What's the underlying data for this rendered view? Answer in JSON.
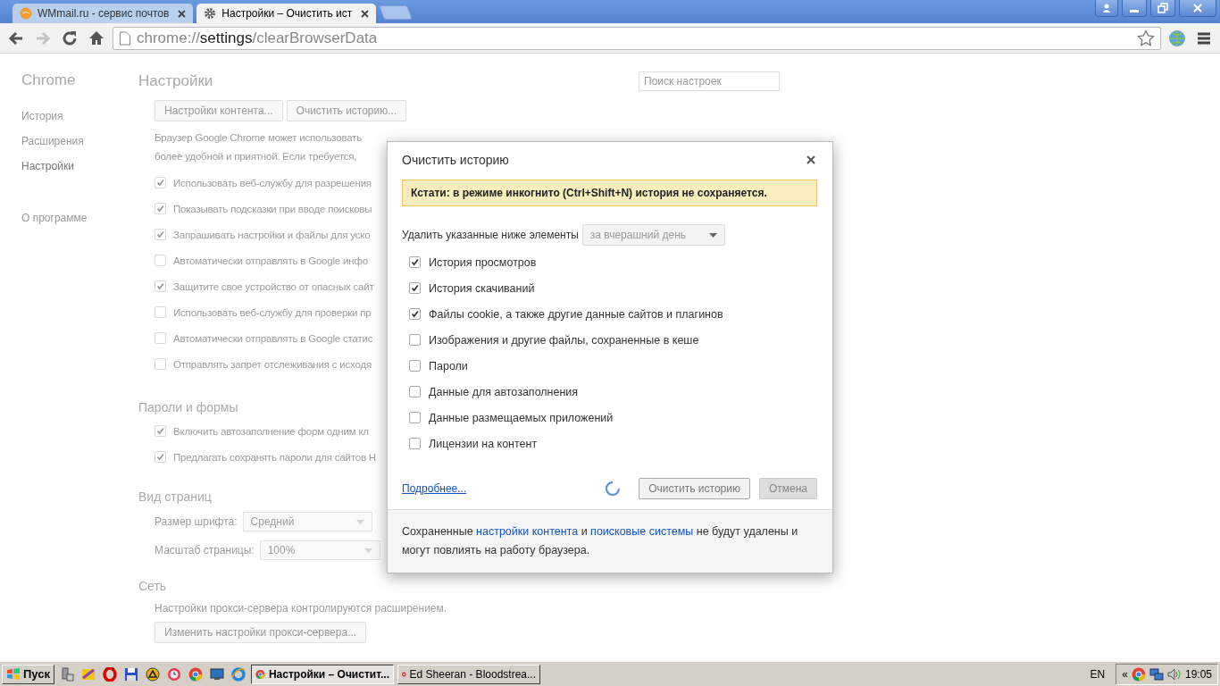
{
  "tabs": [
    {
      "label": "WMmail.ru - сервис почтов",
      "selected": false
    },
    {
      "label": "Настройки – Очистить ист",
      "selected": true
    }
  ],
  "address_bar": {
    "url_parts": [
      "chrome://",
      "settings",
      "/clearBrowserData"
    ]
  },
  "sidebar": {
    "title": "Chrome",
    "items": [
      {
        "label": "История",
        "selected": false
      },
      {
        "label": "Расширения",
        "selected": false
      },
      {
        "label": "Настройки",
        "selected": true
      },
      {
        "label": "О программе",
        "selected": false
      }
    ]
  },
  "settings": {
    "title": "Настройки",
    "search": {
      "placeholder": "Поиск настроек"
    },
    "buttons": [
      "Настройки контента...",
      "Очистить историю..."
    ],
    "description": [
      "Браузер Google Chrome может использовать",
      "более удобной и приятной. Если требуется,"
    ],
    "options": [
      {
        "label": "Использовать веб-службу для разрешения",
        "checked": true
      },
      {
        "label": "Показывать подсказки при вводе поисковы",
        "checked": true
      },
      {
        "label": "Запрашивать настройки и файлы для уско",
        "checked": true
      },
      {
        "label": "Автоматически отправлять в Google инфо",
        "checked": false
      },
      {
        "label": "Защитите свое устройство от опасных сайт",
        "checked": true
      },
      {
        "label": "Использовать веб-службу для проверки пр",
        "checked": false
      },
      {
        "label": "Автоматически отправлять в Google статис",
        "checked": false
      },
      {
        "label": "Отправлять запрет отслеживания с исходя",
        "checked": false
      }
    ],
    "passwords": {
      "title": "Пароли и формы",
      "options": [
        {
          "label": "Включить автозаполнение форм одним кл",
          "checked": true
        },
        {
          "label": "Предлагать сохранять пароли для сайтов Н",
          "checked": true
        }
      ]
    },
    "appearance": {
      "title": "Вид страниц",
      "font_size": {
        "label": "Размер шрифта:",
        "value": "Средний"
      },
      "zoom": {
        "label": "Масштаб страницы:",
        "value": "100%"
      }
    },
    "network": {
      "title": "Сеть",
      "text": "Настройки прокси-сервера контролируются расширением.",
      "button": "Изменить настройки прокси-сервера..."
    }
  },
  "dialog": {
    "title": "Очистить историю",
    "notice": "Кстати: в режиме инкогнито (Ctrl+Shift+N) история не сохраняется.",
    "period": {
      "label": "Удалить указанные ниже элементы",
      "value": "за вчерашний день"
    },
    "items": [
      {
        "label": "История просмотров",
        "checked": true
      },
      {
        "label": "История скачиваний",
        "checked": true
      },
      {
        "label": "Файлы cookie, а также другие данные сайтов и плагинов",
        "checked": true
      },
      {
        "label": "Изображения и другие файлы, сохраненные в кеше",
        "checked": false
      },
      {
        "label": "Пароли",
        "checked": false
      },
      {
        "label": "Данные для автозаполнения",
        "checked": false
      },
      {
        "label": "Данные размещаемых приложений",
        "checked": false
      },
      {
        "label": "Лицензии на контент",
        "checked": false
      }
    ],
    "more_link": "Подробнее...",
    "buttons": [
      {
        "label": "Очистить историю",
        "kind": "primary",
        "disabled": true
      },
      {
        "label": "Отмена",
        "kind": "cancel",
        "disabled": true
      }
    ],
    "footer": [
      {
        "kind": "text",
        "text": "Сохраненные "
      },
      {
        "kind": "link",
        "text": "настройки контента"
      },
      {
        "kind": "text",
        "text": " и "
      },
      {
        "kind": "link",
        "text": "поисковые системы"
      },
      {
        "kind": "text",
        "text": " не будут удалены и могут повлиять на работу браузера."
      }
    ]
  },
  "taskbar": {
    "start": "Пуск",
    "tasks": [
      {
        "label": "Настройки – Очистит...",
        "selected": true
      },
      {
        "label": "Ed Sheeran - Bloodstrea...",
        "selected": false
      }
    ],
    "language": "EN",
    "tray_toggle": "«",
    "clock": "19:05"
  }
}
